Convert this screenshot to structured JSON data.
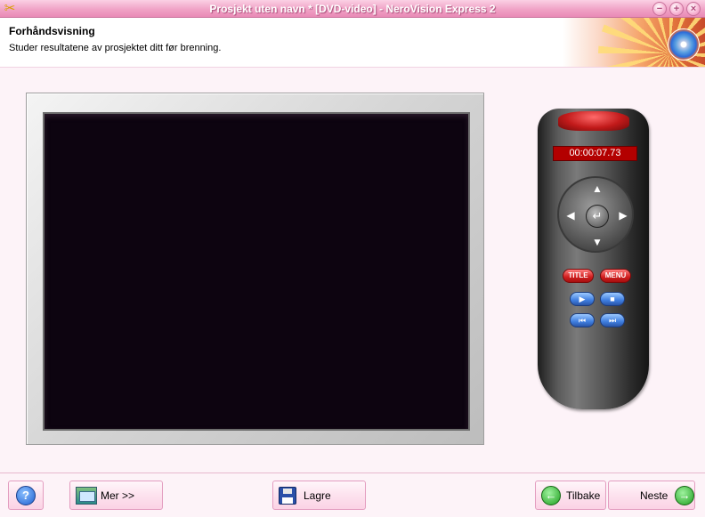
{
  "window": {
    "title": "Prosjekt uten navn * [DVD-video] - NeroVision Express 2",
    "minimize_glyph": "−",
    "maximize_glyph": "+",
    "close_glyph": "×"
  },
  "header": {
    "title": "Forhåndsvisning",
    "subtitle": "Studer resultatene av prosjektet ditt før brenning."
  },
  "remote": {
    "time_display": "00:00:07.73",
    "title_label": "TITLE",
    "menu_label": "MENU",
    "up_glyph": "▲",
    "down_glyph": "▼",
    "left_glyph": "◀",
    "right_glyph": "▶",
    "enter_glyph": "↵",
    "play_glyph": "▶",
    "stop_glyph": "■",
    "prev_glyph": "⏮",
    "next_glyph": "⏭"
  },
  "bottom": {
    "help_glyph": "?",
    "more_label": "Mer >>",
    "save_label": "Lagre",
    "back_label": "Tilbake",
    "next_label": "Neste",
    "back_glyph": "←",
    "next_glyph": "→"
  },
  "colors": {
    "titlebar": "#f0a3c6",
    "screen": "#0d0410",
    "display": "#b30000"
  }
}
